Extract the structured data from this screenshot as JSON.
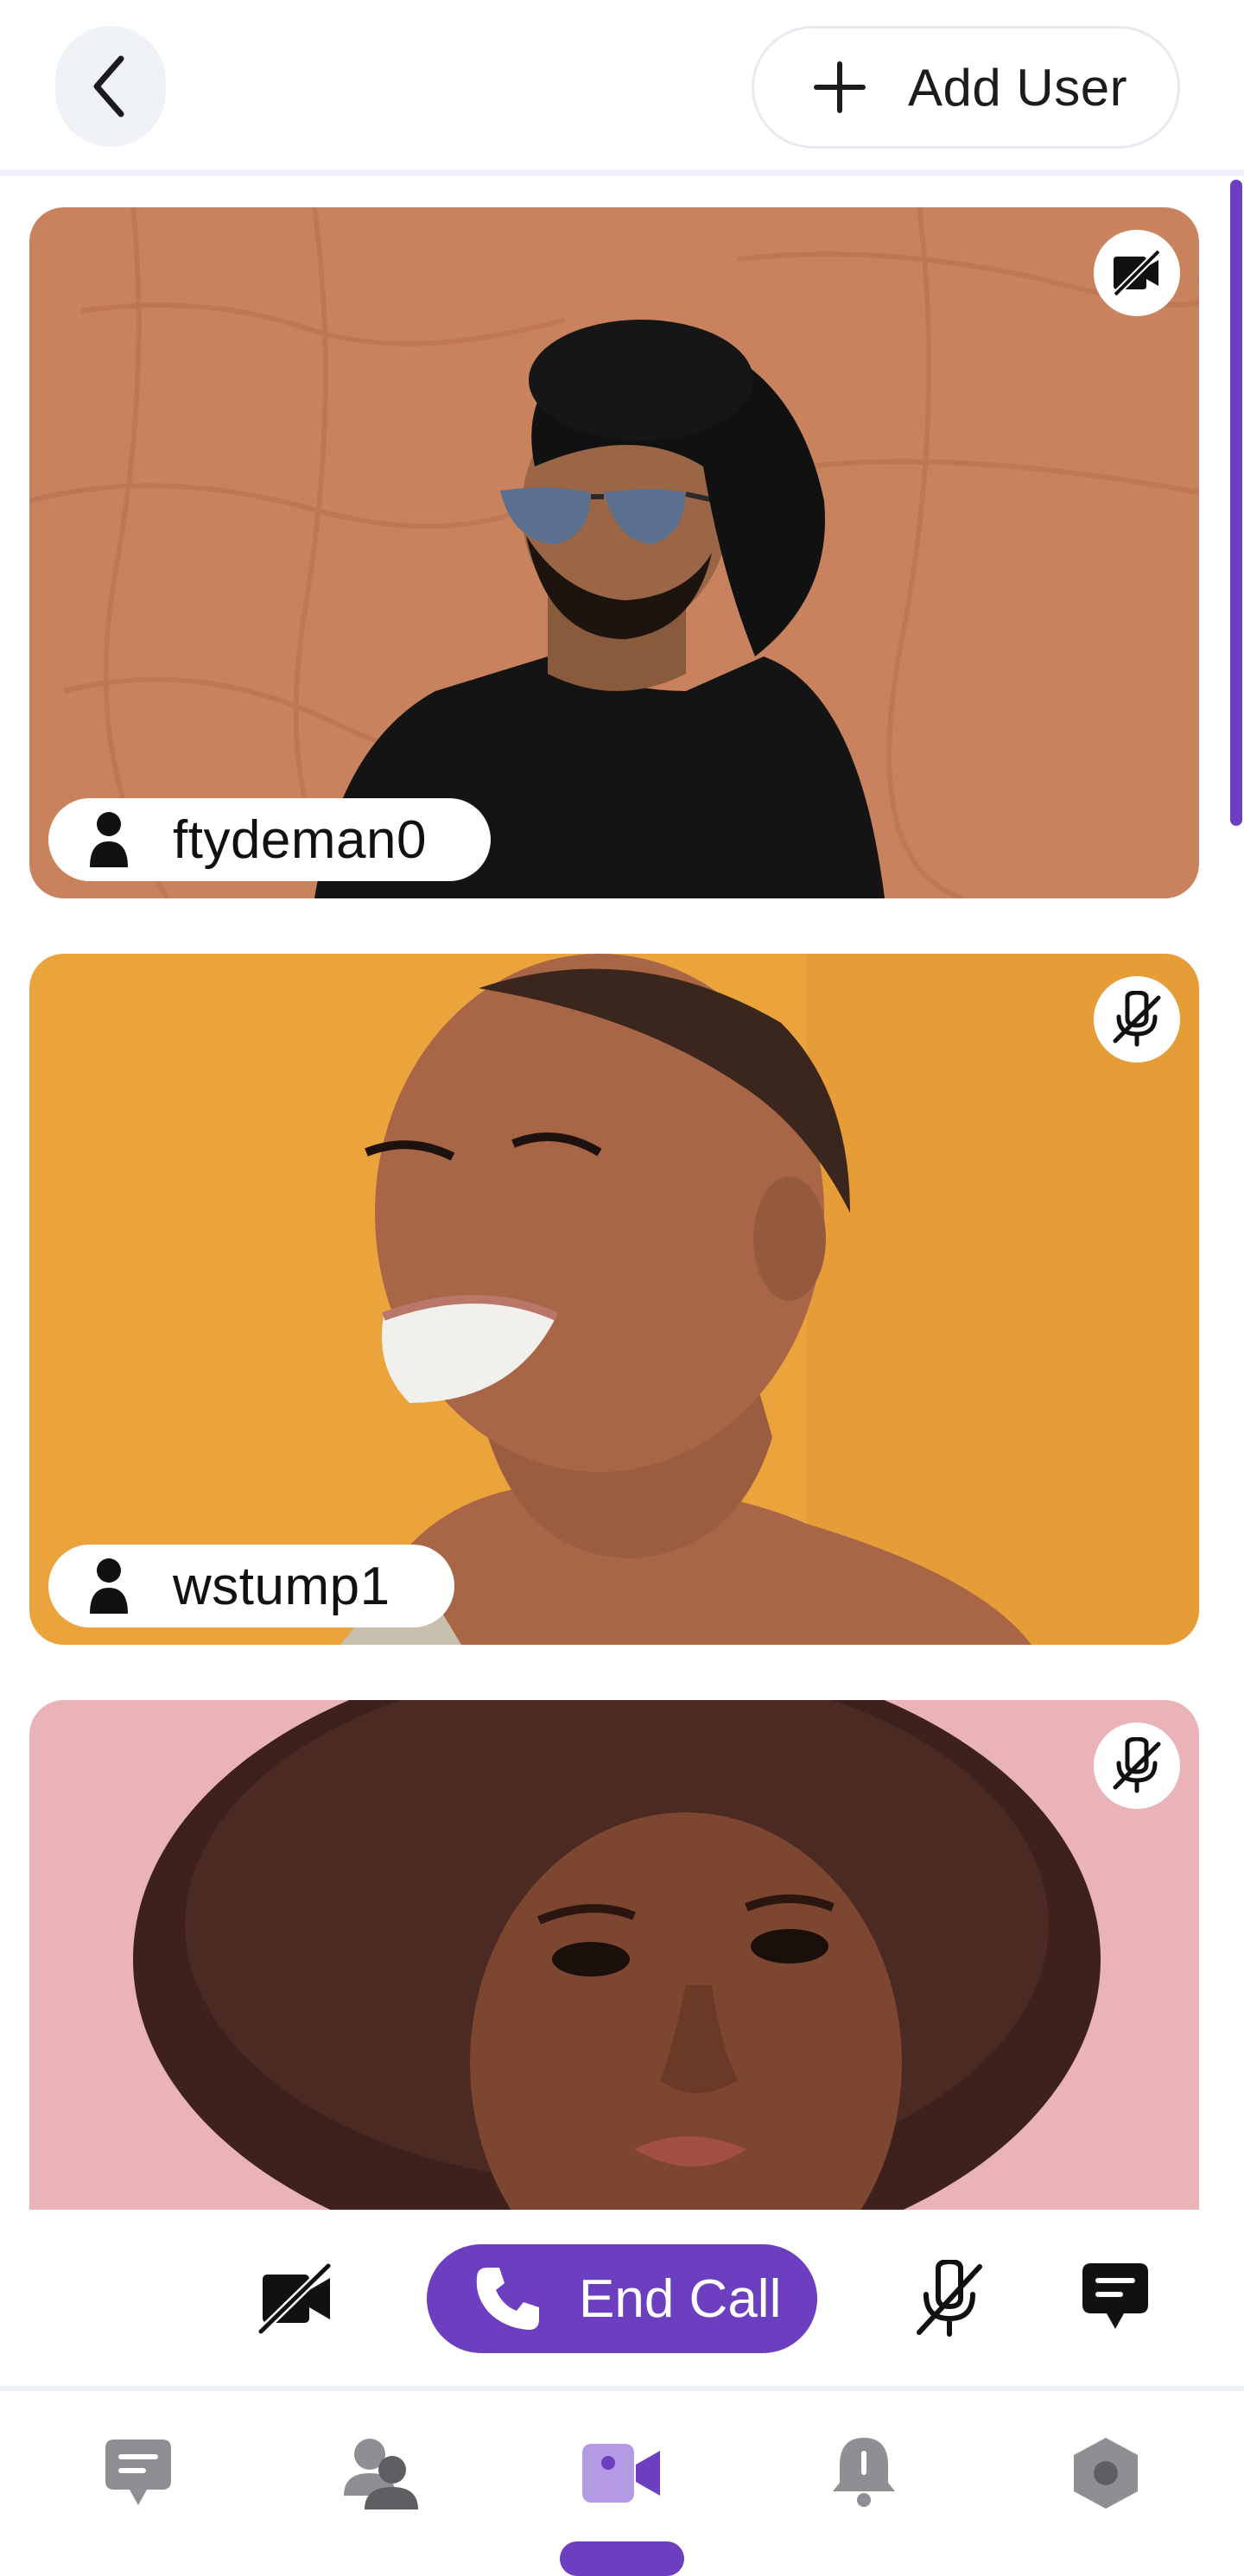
{
  "header": {
    "back_icon": "chevron-left-icon",
    "add_user_icon": "plus-icon",
    "add_user_label": "Add User"
  },
  "participants": [
    {
      "username": "ftydeman0",
      "status_icon": "video-off-icon",
      "avatar_icon": "person-icon"
    },
    {
      "username": "wstump1",
      "status_icon": "mic-off-icon",
      "avatar_icon": "person-icon"
    },
    {
      "username": "",
      "status_icon": "mic-off-icon",
      "avatar_icon": "person-icon"
    }
  ],
  "controls": {
    "camera_icon": "video-off-icon",
    "end_call_icon": "phone-icon",
    "end_call_label": "End Call",
    "mic_icon": "mic-off-icon",
    "chat_icon": "chat-icon"
  },
  "bottom_nav": {
    "items": [
      {
        "icon": "chat-icon",
        "active": false
      },
      {
        "icon": "users-icon",
        "active": false
      },
      {
        "icon": "video-icon",
        "active": true
      },
      {
        "icon": "bell-icon",
        "active": false
      },
      {
        "icon": "settings-hex-icon",
        "active": false
      }
    ]
  },
  "colors": {
    "accent": "#6c3fc0",
    "accent_light": "#b39ae3",
    "nav_inactive": "#8e8e93",
    "tile1_bg": "#c9825e",
    "tile2_bg": "#eba43c",
    "tile3_bg": "#e9b3b8"
  }
}
